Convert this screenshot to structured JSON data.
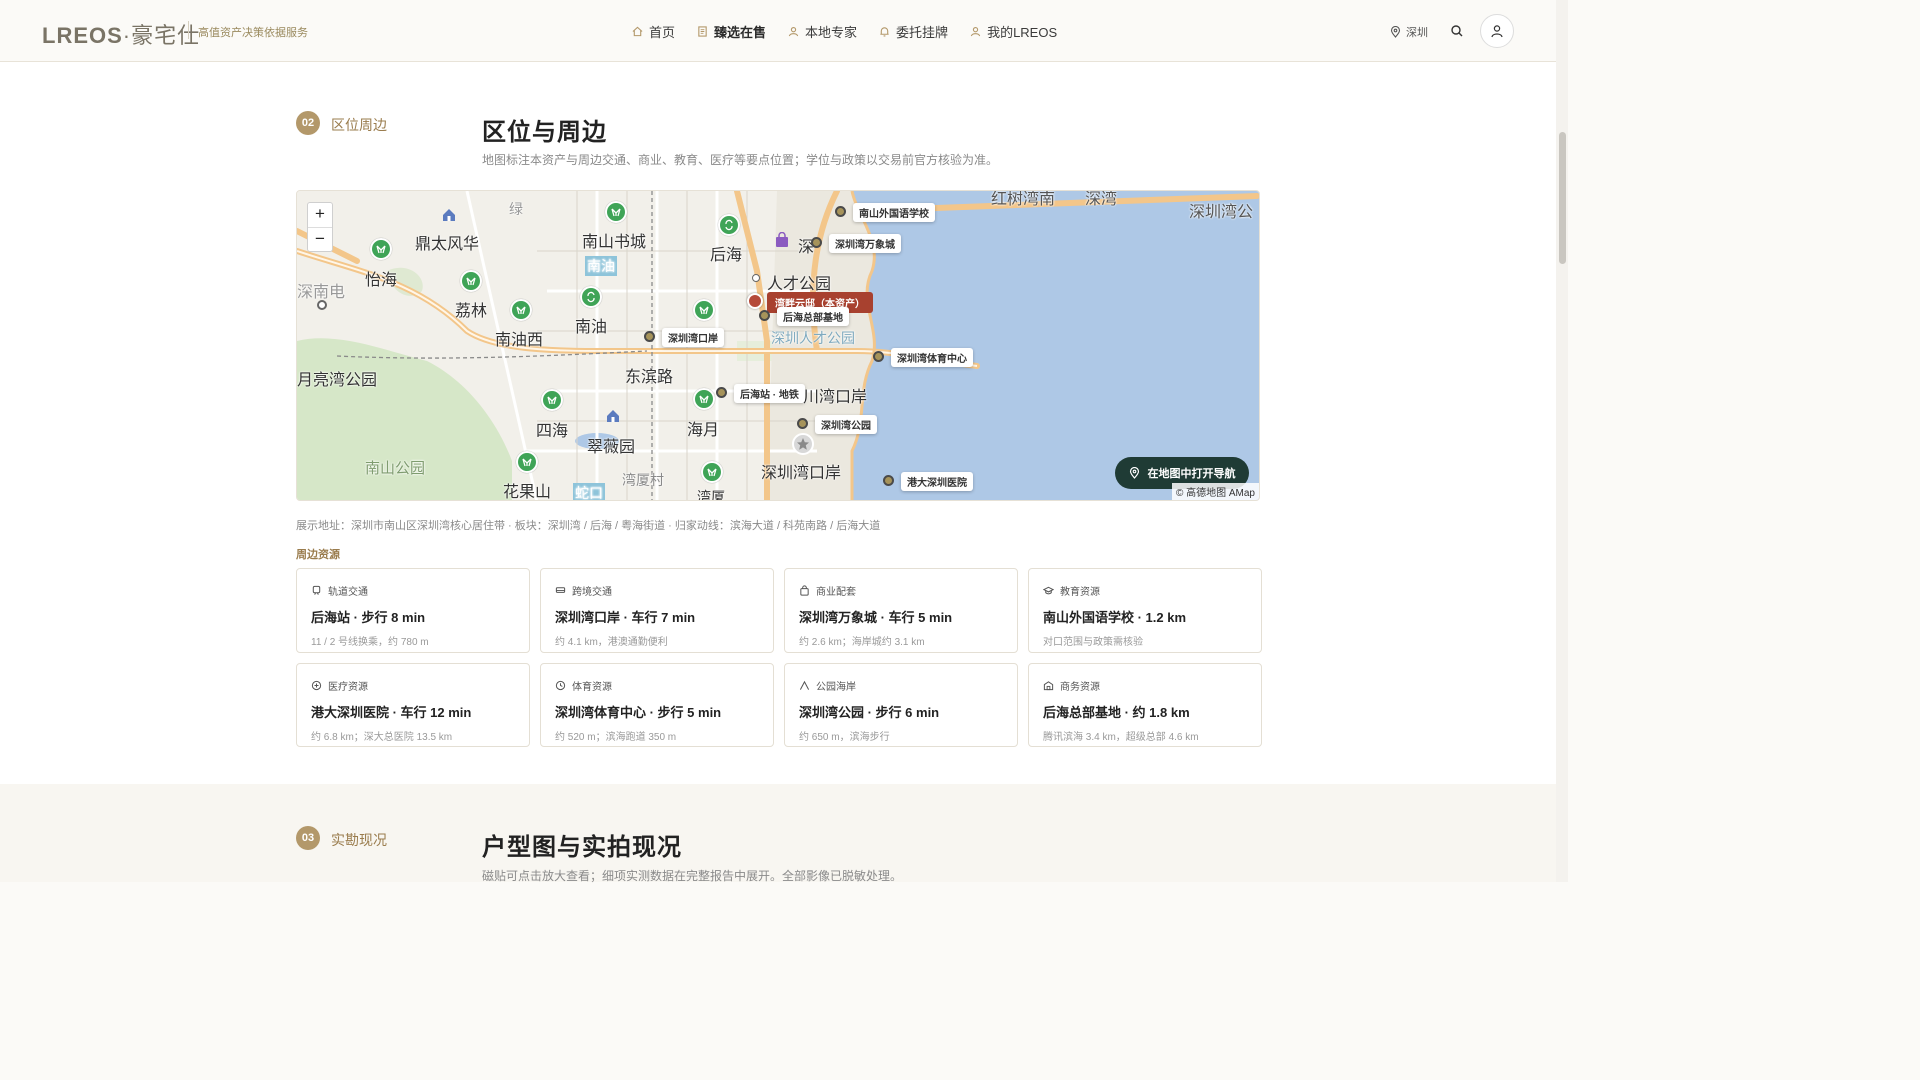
{
  "header": {
    "logo": "LREOS",
    "logo_cn": "·豪宅仕",
    "tagline": "高值资产决策依据服务",
    "nav": [
      {
        "label": "首页",
        "icon": "home-icon",
        "active": false
      },
      {
        "label": "臻选在售",
        "icon": "document-icon",
        "active": true
      },
      {
        "label": "本地专家",
        "icon": "person-icon",
        "active": false
      },
      {
        "label": "委托挂牌",
        "icon": "bell-icon",
        "active": false
      },
      {
        "label": "我的LREOS",
        "icon": "person-icon",
        "active": false
      }
    ],
    "city": "深圳"
  },
  "section2": {
    "num": "02",
    "label": "区位周边",
    "title": "区位与周边",
    "desc": "地图标注本资产与周边交通、商业、教育、医疗等要点位置；学位与政策以交易前官方核验为准。"
  },
  "map": {
    "zoom_in": "+",
    "zoom_out": "−",
    "place_labels": {
      "dingtai": "鼎太风华",
      "nanshan_bookcity": "南山书城",
      "houhai": "后海",
      "yihai": "怡海",
      "nanyou": "南油",
      "nanyou2": "南油",
      "lilin": "荔林",
      "nanyouxi": "南油西",
      "rencai": "人才公园",
      "shenzhen_bay_park": "深圳人才公园",
      "dongbin": "东滨路",
      "yueliangwan": "月亮湾公园",
      "sihai": "四海",
      "cuiwei": "翠薇园",
      "haiyue": "海月",
      "kouan": "川湾口岸",
      "nanshan_park": "南山公园",
      "huaguoshan": "花果山",
      "shekou": "蛇口",
      "wanxiacun": "湾厦村",
      "sz_kouan": "深圳湾口岸",
      "sz_bay": "深圳湾公",
      "hongshuwan": "红树湾南",
      "shenwan": "深湾",
      "wanxia": "湾厦",
      "nanshandian": "深南电",
      "luyuan": "绿",
      "shen": "深"
    },
    "pois": [
      {
        "name": "南山外国语学校"
      },
      {
        "name": "深圳湾万象城"
      },
      {
        "name": "后海总部基地"
      },
      {
        "name": "深圳湾口岸"
      },
      {
        "name": "深圳湾体育中心"
      },
      {
        "name": "后海站 · 地铁"
      },
      {
        "name": "深圳湾公园"
      },
      {
        "name": "港大深圳医院"
      }
    ],
    "main_asset": "湾畔云邸（本资产）",
    "nav_button": "在地图中打开导航",
    "attribution": "© 高德地图 AMap"
  },
  "address_line": "展示地址：深圳市南山区深圳湾核心居住带 · 板块：深圳湾 / 后海 / 粤海街道 · 归家动线：滨海大道 / 科苑南路 / 后海大道",
  "resources_title": "周边资源",
  "resources": [
    {
      "category": "轨道交通",
      "icon": "train-icon",
      "main": "后海站 · 步行 8 min",
      "sub": "11 / 2 号线换乘，约 780 m"
    },
    {
      "category": "跨境交通",
      "icon": "bus-icon",
      "main": "深圳湾口岸 · 车行 7 min",
      "sub": "约 4.1 km，港澳通勤便利"
    },
    {
      "category": "商业配套",
      "icon": "shopping-bag-icon",
      "main": "深圳湾万象城 · 车行 5 min",
      "sub": "约 2.6 km；海岸城约 3.1 km"
    },
    {
      "category": "教育资源",
      "icon": "graduation-cap-icon",
      "main": "南山外国语学校 · 1.2 km",
      "sub": "对口范围与政策需核验"
    },
    {
      "category": "医疗资源",
      "icon": "medical-plus-icon",
      "main": "港大深圳医院 · 车行 12 min",
      "sub": "约 6.8 km；深大总医院 13.5 km"
    },
    {
      "category": "体育资源",
      "icon": "clock-icon",
      "main": "深圳湾体育中心 · 步行 5 min",
      "sub": "约 520 m；滨海跑道 350 m"
    },
    {
      "category": "公园海岸",
      "icon": "person-walk-icon",
      "main": "深圳湾公园 · 步行 6 min",
      "sub": "约 650 m，滨海步行"
    },
    {
      "category": "商务资源",
      "icon": "office-building-icon",
      "main": "后海总部基地 · 约 1.8 km",
      "sub": "腾讯滨海 3.4 km，超级总部 4.6 km"
    }
  ],
  "section3": {
    "num": "03",
    "label": "实勘现况",
    "title": "户型图与实拍现况",
    "desc": "磁贴可点击放大查看；细项实测数据在完整报告中展开。全部影像已脱敏处理。"
  }
}
